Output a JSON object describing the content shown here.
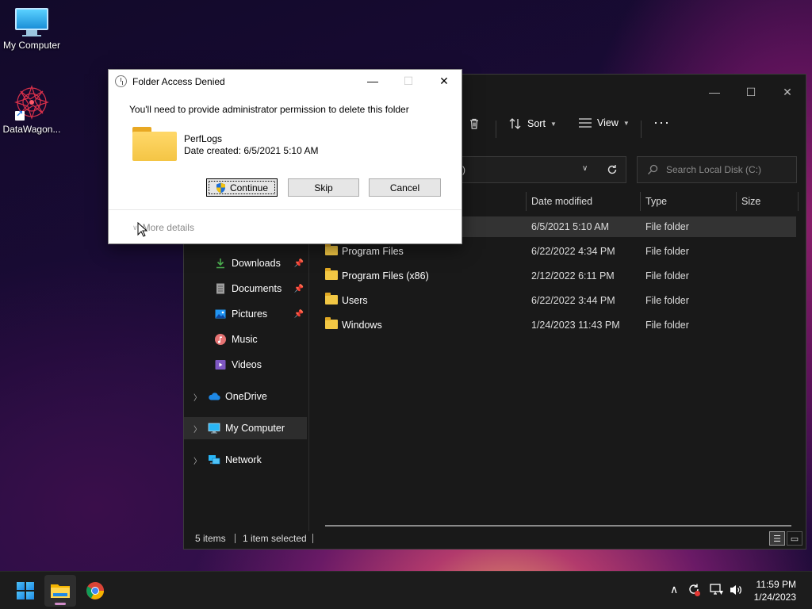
{
  "desktop": {
    "icons": [
      {
        "label": "My Computer"
      },
      {
        "label": "DataWagon..."
      }
    ]
  },
  "explorer": {
    "toolbar": {
      "sort_label": "Sort",
      "view_label": "View",
      "more_label": "···"
    },
    "address_partial": ")",
    "search_placeholder": "Search Local Disk (C:)",
    "nav": [
      {
        "label": "Downloads",
        "icon": "download-icon",
        "pinned": true
      },
      {
        "label": "Documents",
        "icon": "document-icon",
        "pinned": true
      },
      {
        "label": "Pictures",
        "icon": "pictures-icon",
        "pinned": true
      },
      {
        "label": "Music",
        "icon": "music-icon",
        "pinned": false
      },
      {
        "label": "Videos",
        "icon": "videos-icon",
        "pinned": false
      },
      {
        "label": "OneDrive",
        "icon": "cloud-icon",
        "expandable": true
      },
      {
        "label": "My Computer",
        "icon": "computer-icon",
        "expandable": true,
        "selected": true
      },
      {
        "label": "Network",
        "icon": "network-icon",
        "expandable": true
      }
    ],
    "columns": {
      "date": "Date modified",
      "type": "Type",
      "size": "Size"
    },
    "rows": [
      {
        "name": "",
        "date": "6/5/2021 5:10 AM",
        "type": "File folder",
        "selected": true
      },
      {
        "name": "Program Files",
        "date": "6/22/2022 4:34 PM",
        "type": "File folder"
      },
      {
        "name": "Program Files (x86)",
        "date": "2/12/2022 6:11 PM",
        "type": "File folder"
      },
      {
        "name": "Users",
        "date": "6/22/2022 3:44 PM",
        "type": "File folder"
      },
      {
        "name": "Windows",
        "date": "1/24/2023 11:43 PM",
        "type": "File folder"
      }
    ],
    "status": {
      "items": "5 items",
      "selected": "1 item selected"
    }
  },
  "dialog": {
    "title": "Folder Access Denied",
    "message": "You'll need to provide administrator permission to delete this folder",
    "folder_name": "PerfLogs",
    "date_created": "Date created: 6/5/2021 5:10 AM",
    "buttons": {
      "continue": "Continue",
      "skip": "Skip",
      "cancel": "Cancel"
    },
    "more_details": "More details"
  },
  "taskbar": {
    "time": "11:59 PM",
    "date": "1/24/2023"
  },
  "colors": {
    "folder": "#f2c744",
    "accent": "#1e88e5",
    "explorer_bg": "#191919"
  }
}
